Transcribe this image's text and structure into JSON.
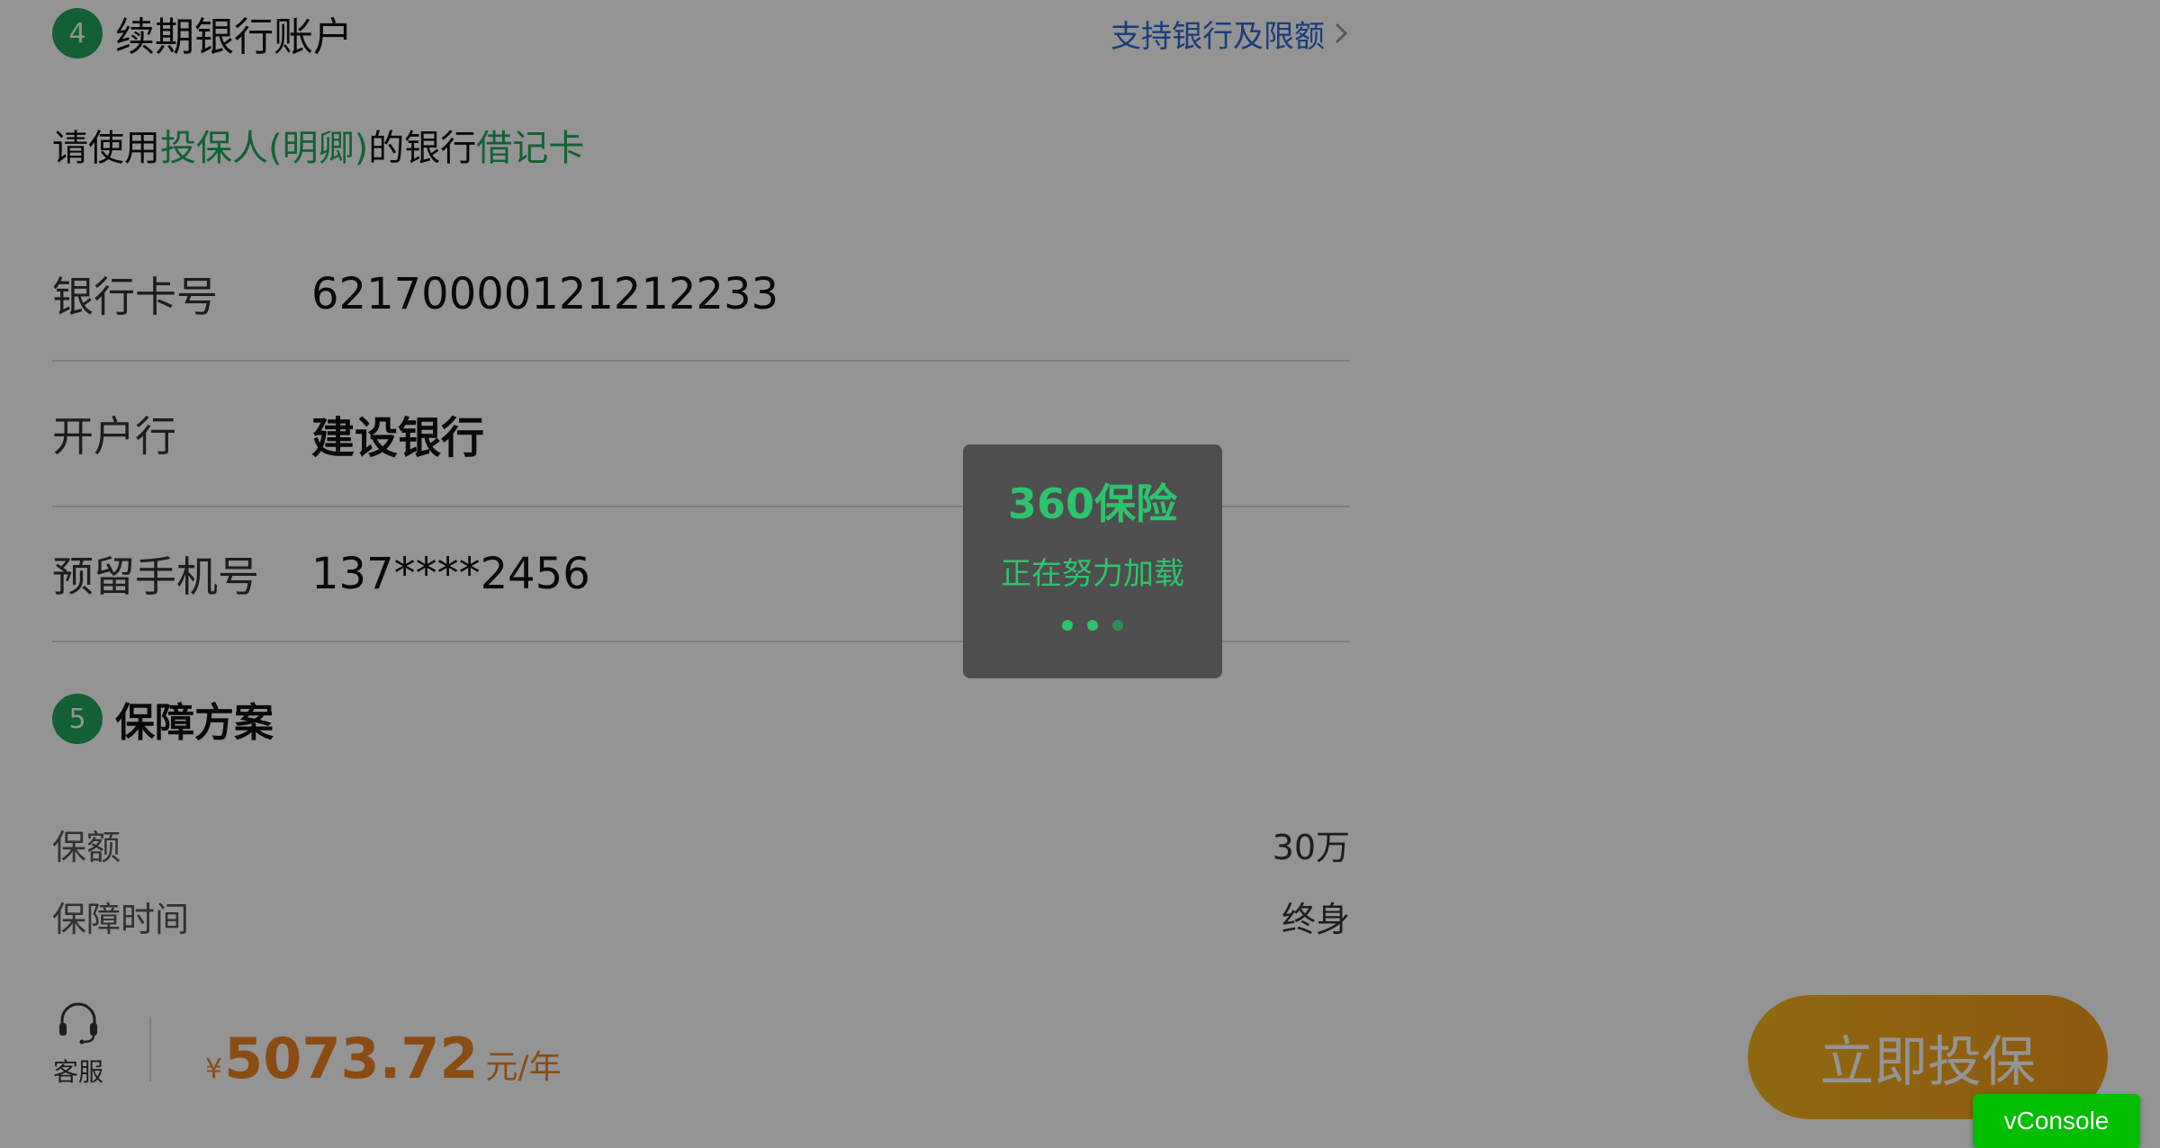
{
  "colors": {
    "brand_green": "#1fa55a",
    "link_blue": "#2e6bd4",
    "price_orange": "#f08422",
    "cta_gradient_start": "#f5b51c",
    "cta_gradient_end": "#f39a1b",
    "loading_green": "#2fc26e",
    "vconsole_green": "#04be02"
  },
  "renewal_section": {
    "step": "4",
    "title": "续期银行账户",
    "support_link": "支持银行及限额",
    "support_link_icon": "chevron-right-icon",
    "notice": {
      "prefix": "请使用",
      "holder": "投保人(明卿)",
      "middle": "的银行",
      "card_type": "借记卡"
    },
    "fields": [
      {
        "label": "银行卡号",
        "value": "62170000121212233"
      },
      {
        "label": "开户行",
        "value": "建设银行"
      },
      {
        "label": "预留手机号",
        "value": "137****2456"
      }
    ]
  },
  "plan_section": {
    "step": "5",
    "title": "保障方案",
    "rows": [
      {
        "label": "保额",
        "value": "30万"
      },
      {
        "label": "保障时间",
        "value": "终身"
      }
    ]
  },
  "bottom_bar": {
    "service_icon": "headset-icon",
    "service_label": "客服",
    "currency": "¥",
    "price": "5073.72",
    "unit": "元/年",
    "cta_label": "立即投保"
  },
  "loading": {
    "logo": "360保险",
    "text": "正在努力加载"
  },
  "vconsole_label": "vConsole"
}
